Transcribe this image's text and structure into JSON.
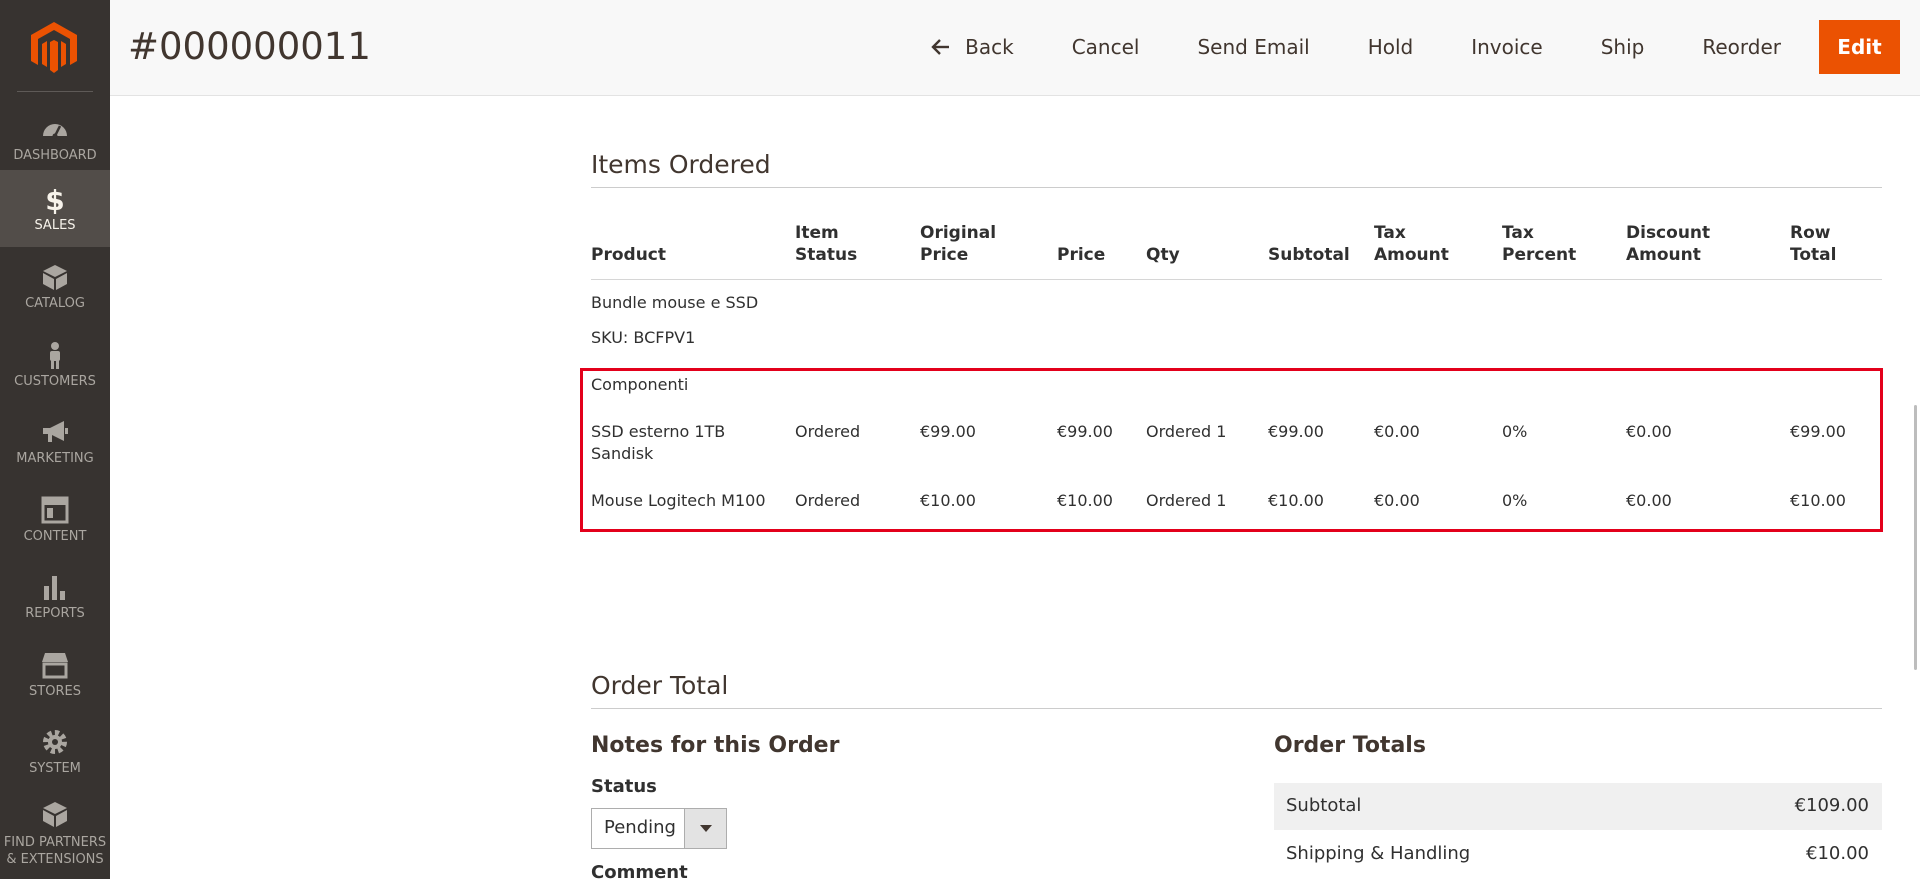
{
  "sidebar": {
    "items": [
      {
        "label": "DASHBOARD",
        "icon": "dashboard-icon"
      },
      {
        "label": "SALES",
        "icon": "dollar-icon",
        "active": true
      },
      {
        "label": "CATALOG",
        "icon": "cube-icon"
      },
      {
        "label": "CUSTOMERS",
        "icon": "person-icon"
      },
      {
        "label": "MARKETING",
        "icon": "megaphone-icon"
      },
      {
        "label": "CONTENT",
        "icon": "layout-icon"
      },
      {
        "label": "REPORTS",
        "icon": "bar-chart-icon"
      },
      {
        "label": "STORES",
        "icon": "storefront-icon"
      },
      {
        "label": "SYSTEM",
        "icon": "gear-icon"
      },
      {
        "label_line1": "FIND PARTNERS",
        "label_line2": "& EXTENSIONS",
        "icon": "blocks-icon"
      }
    ]
  },
  "header": {
    "title": "#000000011",
    "actions": {
      "back": "Back",
      "cancel": "Cancel",
      "send_email": "Send Email",
      "hold": "Hold",
      "invoice": "Invoice",
      "ship": "Ship",
      "reorder": "Reorder",
      "edit": "Edit"
    },
    "accent_color": "#eb5202"
  },
  "items_ordered": {
    "title": "Items Ordered",
    "columns": {
      "product": "Product",
      "item_status_1": "Item",
      "item_status_2": "Status",
      "original_price_1": "Original",
      "original_price_2": "Price",
      "price": "Price",
      "qty": "Qty",
      "subtotal": "Subtotal",
      "tax_amount_1": "Tax",
      "tax_amount_2": "Amount",
      "tax_percent_1": "Tax",
      "tax_percent_2": "Percent",
      "discount_amount_1": "Discount",
      "discount_amount_2": "Amount",
      "row_total_1": "Row",
      "row_total_2": "Total"
    },
    "bundle": {
      "name": "Bundle mouse e SSD",
      "sku": "SKU: BCFPV1",
      "components_label": "Componenti"
    },
    "rows": [
      {
        "product_1": "SSD esterno 1TB",
        "product_2": "Sandisk",
        "status": "Ordered",
        "original_price": "€99.00",
        "price": "€99.00",
        "qty": "Ordered 1",
        "subtotal": "€99.00",
        "tax_amount": "€0.00",
        "tax_percent": "0%",
        "discount": "€0.00",
        "row_total": "€99.00"
      },
      {
        "product_1": "Mouse Logitech M100",
        "product_2": "",
        "status": "Ordered",
        "original_price": "€10.00",
        "price": "€10.00",
        "qty": "Ordered 1",
        "subtotal": "€10.00",
        "tax_amount": "€0.00",
        "tax_percent": "0%",
        "discount": "€0.00",
        "row_total": "€10.00"
      }
    ]
  },
  "order_total": {
    "title": "Order Total",
    "notes_title": "Notes for this Order",
    "status_label": "Status",
    "status_value": "Pending",
    "comment_label": "Comment",
    "totals_title": "Order Totals",
    "totals": [
      {
        "label": "Subtotal",
        "value": "€109.00"
      },
      {
        "label": "Shipping & Handling",
        "value": "€10.00"
      }
    ]
  }
}
